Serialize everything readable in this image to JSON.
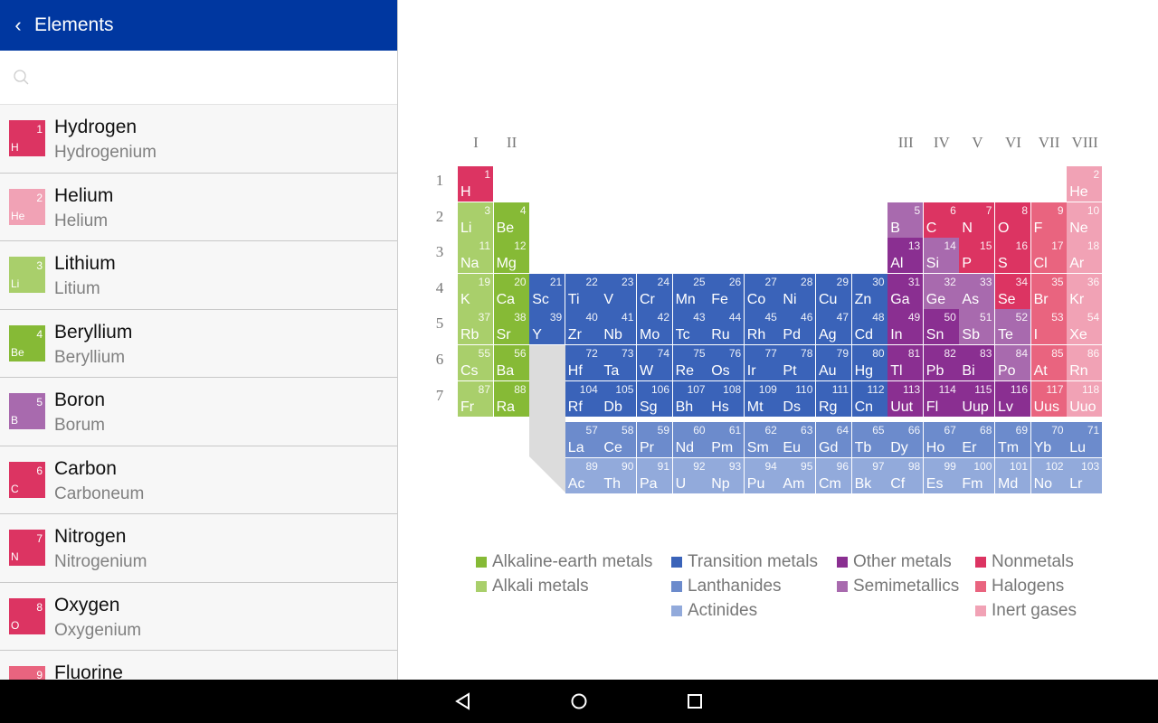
{
  "header": {
    "title": "Elements",
    "back_icon": "chevron-left-icon"
  },
  "search": {
    "placeholder": "",
    "icon": "search-icon"
  },
  "list": [
    {
      "name": "Hydrogen",
      "latin": "Hydrogenium",
      "symbol": "H",
      "number": "1",
      "category": "nm"
    },
    {
      "name": "Helium",
      "latin": "Helium",
      "symbol": "He",
      "number": "2",
      "category": "ig"
    },
    {
      "name": "Lithium",
      "latin": "Litium",
      "symbol": "Li",
      "number": "3",
      "category": "am"
    },
    {
      "name": "Beryllium",
      "latin": "Beryllium",
      "symbol": "Be",
      "number": "4",
      "category": "ae"
    },
    {
      "name": "Boron",
      "latin": "Borum",
      "symbol": "B",
      "number": "5",
      "category": "sm"
    },
    {
      "name": "Carbon",
      "latin": "Carboneum",
      "symbol": "C",
      "number": "6",
      "category": "nm"
    },
    {
      "name": "Nitrogen",
      "latin": "Nitrogenium",
      "symbol": "N",
      "number": "7",
      "category": "nm"
    },
    {
      "name": "Oxygen",
      "latin": "Oxygenium",
      "symbol": "O",
      "number": "8",
      "category": "nm"
    },
    {
      "name": "Fluorine",
      "latin": "",
      "symbol": "F",
      "number": "9",
      "category": "ha"
    }
  ],
  "colors": {
    "ae": "#86ba36",
    "am": "#a9cf6b",
    "tm": "#3a63b9",
    "la": "#6c8bcc",
    "ac": "#92aadb",
    "om": "#8a2f91",
    "sm": "#a86aae",
    "nm": "#dc3462",
    "ha": "#e9647f",
    "ig": "#f1a2b5"
  },
  "groups": [
    "I",
    "II",
    "III",
    "IV",
    "V",
    "VI",
    "VII",
    "VIII"
  ],
  "periods": [
    "1",
    "2",
    "3",
    "4",
    "5",
    "6",
    "7"
  ],
  "legend": [
    {
      "key": "ae",
      "label": "Alkaline-earth metals"
    },
    {
      "key": "am",
      "label": "Alkali metals"
    },
    {
      "key": "tm",
      "label": "Transition metals"
    },
    {
      "key": "la",
      "label": "Lanthanides"
    },
    {
      "key": "ac",
      "label": "Actinides"
    },
    {
      "key": "om",
      "label": "Other metals"
    },
    {
      "key": "sm",
      "label": "Semimetallics"
    },
    {
      "key": "nm",
      "label": "Nonmetals"
    },
    {
      "key": "ha",
      "label": "Halogens"
    },
    {
      "key": "ig",
      "label": "Inert gases"
    }
  ],
  "main_table": [
    [
      "H",
      1,
      "nm",
      1,
      1
    ],
    [
      "He",
      2,
      "ig",
      1,
      18
    ],
    [
      "Li",
      3,
      "am",
      2,
      1
    ],
    [
      "Be",
      4,
      "ae",
      2,
      2
    ],
    [
      "B",
      5,
      "sm",
      2,
      13
    ],
    [
      "C",
      6,
      "nm",
      2,
      14
    ],
    [
      "N",
      7,
      "nm",
      2,
      15
    ],
    [
      "O",
      8,
      "nm",
      2,
      16
    ],
    [
      "F",
      9,
      "ha",
      2,
      17
    ],
    [
      "Ne",
      10,
      "ig",
      2,
      18
    ],
    [
      "Na",
      11,
      "am",
      3,
      1
    ],
    [
      "Mg",
      12,
      "ae",
      3,
      2
    ],
    [
      "Al",
      13,
      "om",
      3,
      13
    ],
    [
      "Si",
      14,
      "sm",
      3,
      14
    ],
    [
      "P",
      15,
      "nm",
      3,
      15
    ],
    [
      "S",
      16,
      "nm",
      3,
      16
    ],
    [
      "Cl",
      17,
      "ha",
      3,
      17
    ],
    [
      "Ar",
      18,
      "ig",
      3,
      18
    ],
    [
      "K",
      19,
      "am",
      4,
      1
    ],
    [
      "Ca",
      20,
      "ae",
      4,
      2
    ],
    [
      "Sc",
      21,
      "tm",
      4,
      3
    ],
    [
      "Ti",
      22,
      "tm",
      4,
      4
    ],
    [
      "V",
      23,
      "tm",
      4,
      5
    ],
    [
      "Cr",
      24,
      "tm",
      4,
      6
    ],
    [
      "Mn",
      25,
      "tm",
      4,
      7
    ],
    [
      "Fe",
      26,
      "tm",
      4,
      8
    ],
    [
      "Co",
      27,
      "tm",
      4,
      9
    ],
    [
      "Ni",
      28,
      "tm",
      4,
      10
    ],
    [
      "Cu",
      29,
      "tm",
      4,
      11
    ],
    [
      "Zn",
      30,
      "tm",
      4,
      12
    ],
    [
      "Ga",
      31,
      "om",
      4,
      13
    ],
    [
      "Ge",
      32,
      "sm",
      4,
      14
    ],
    [
      "As",
      33,
      "sm",
      4,
      15
    ],
    [
      "Se",
      34,
      "nm",
      4,
      16
    ],
    [
      "Br",
      35,
      "ha",
      4,
      17
    ],
    [
      "Kr",
      36,
      "ig",
      4,
      18
    ],
    [
      "Rb",
      37,
      "am",
      5,
      1
    ],
    [
      "Sr",
      38,
      "ae",
      5,
      2
    ],
    [
      "Y",
      39,
      "tm",
      5,
      3
    ],
    [
      "Zr",
      40,
      "tm",
      5,
      4
    ],
    [
      "Nb",
      41,
      "tm",
      5,
      5
    ],
    [
      "Mo",
      42,
      "tm",
      5,
      6
    ],
    [
      "Tc",
      43,
      "tm",
      5,
      7
    ],
    [
      "Ru",
      44,
      "tm",
      5,
      8
    ],
    [
      "Rh",
      45,
      "tm",
      5,
      9
    ],
    [
      "Pd",
      46,
      "tm",
      5,
      10
    ],
    [
      "Ag",
      47,
      "tm",
      5,
      11
    ],
    [
      "Cd",
      48,
      "tm",
      5,
      12
    ],
    [
      "In",
      49,
      "om",
      5,
      13
    ],
    [
      "Sn",
      50,
      "om",
      5,
      14
    ],
    [
      "Sb",
      51,
      "sm",
      5,
      15
    ],
    [
      "Te",
      52,
      "sm",
      5,
      16
    ],
    [
      "I",
      53,
      "ha",
      5,
      17
    ],
    [
      "Xe",
      54,
      "ig",
      5,
      18
    ],
    [
      "Cs",
      55,
      "am",
      6,
      1
    ],
    [
      "Ba",
      56,
      "ae",
      6,
      2
    ],
    [
      "Hf",
      72,
      "tm",
      6,
      4
    ],
    [
      "Ta",
      73,
      "tm",
      6,
      5
    ],
    [
      "W",
      74,
      "tm",
      6,
      6
    ],
    [
      "Re",
      75,
      "tm",
      6,
      7
    ],
    [
      "Os",
      76,
      "tm",
      6,
      8
    ],
    [
      "Ir",
      77,
      "tm",
      6,
      9
    ],
    [
      "Pt",
      78,
      "tm",
      6,
      10
    ],
    [
      "Au",
      79,
      "tm",
      6,
      11
    ],
    [
      "Hg",
      80,
      "tm",
      6,
      12
    ],
    [
      "Tl",
      81,
      "om",
      6,
      13
    ],
    [
      "Pb",
      82,
      "om",
      6,
      14
    ],
    [
      "Bi",
      83,
      "om",
      6,
      15
    ],
    [
      "Po",
      84,
      "sm",
      6,
      16
    ],
    [
      "At",
      85,
      "ha",
      6,
      17
    ],
    [
      "Rn",
      86,
      "ig",
      6,
      18
    ],
    [
      "Fr",
      87,
      "am",
      7,
      1
    ],
    [
      "Ra",
      88,
      "ae",
      7,
      2
    ],
    [
      "Rf",
      104,
      "tm",
      7,
      4
    ],
    [
      "Db",
      105,
      "tm",
      7,
      5
    ],
    [
      "Sg",
      106,
      "tm",
      7,
      6
    ],
    [
      "Bh",
      107,
      "tm",
      7,
      7
    ],
    [
      "Hs",
      108,
      "tm",
      7,
      8
    ],
    [
      "Mt",
      109,
      "tm",
      7,
      9
    ],
    [
      "Ds",
      110,
      "tm",
      7,
      10
    ],
    [
      "Rg",
      111,
      "tm",
      7,
      11
    ],
    [
      "Cn",
      112,
      "tm",
      7,
      12
    ],
    [
      "Uut",
      113,
      "om",
      7,
      13
    ],
    [
      "Fl",
      114,
      "om",
      7,
      14
    ],
    [
      "Uup",
      115,
      "om",
      7,
      15
    ],
    [
      "Lv",
      116,
      "om",
      7,
      16
    ],
    [
      "Uus",
      117,
      "ha",
      7,
      17
    ],
    [
      "Uuo",
      118,
      "ig",
      7,
      18
    ]
  ],
  "lanthanides": [
    [
      "La",
      57
    ],
    [
      "Ce",
      58
    ],
    [
      "Pr",
      59
    ],
    [
      "Nd",
      60
    ],
    [
      "Pm",
      61
    ],
    [
      "Sm",
      62
    ],
    [
      "Eu",
      63
    ],
    [
      "Gd",
      64
    ],
    [
      "Tb",
      65
    ],
    [
      "Dy",
      66
    ],
    [
      "Ho",
      67
    ],
    [
      "Er",
      68
    ],
    [
      "Tm",
      69
    ],
    [
      "Yb",
      70
    ],
    [
      "Lu",
      71
    ]
  ],
  "actinides": [
    [
      "Ac",
      89
    ],
    [
      "Th",
      90
    ],
    [
      "Pa",
      91
    ],
    [
      "U",
      92
    ],
    [
      "Np",
      93
    ],
    [
      "Pu",
      94
    ],
    [
      "Am",
      95
    ],
    [
      "Cm",
      96
    ],
    [
      "Bk",
      97
    ],
    [
      "Cf",
      98
    ],
    [
      "Es",
      99
    ],
    [
      "Fm",
      100
    ],
    [
      "Md",
      101
    ],
    [
      "No",
      102
    ],
    [
      "Lr",
      103
    ]
  ]
}
